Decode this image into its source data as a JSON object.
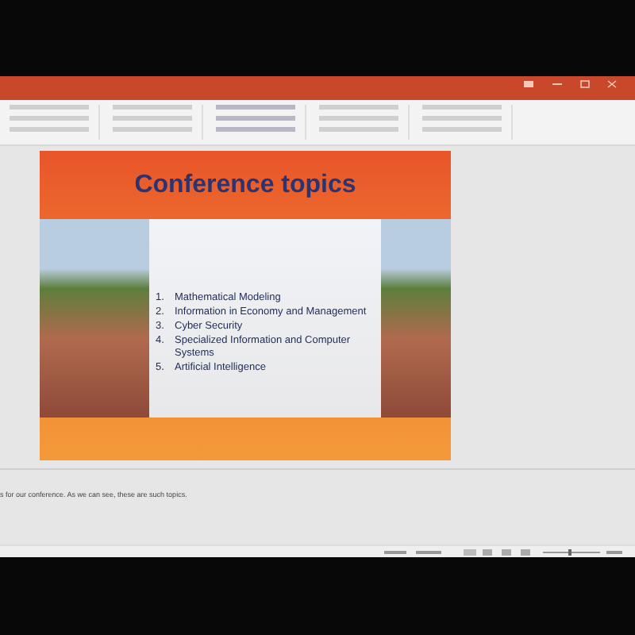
{
  "slide": {
    "title": "Conference topics",
    "topics": [
      {
        "number": "1.",
        "text": "Mathematical Modeling"
      },
      {
        "number": "2.",
        "text": "Information in Economy and Management"
      },
      {
        "number": "3.",
        "text": "Cyber Security"
      },
      {
        "number": "4.",
        "text": "Specialized Information and Computer Systems"
      },
      {
        "number": "5.",
        "text": "Artificial Intelligence"
      }
    ]
  },
  "notes": {
    "text": "s for our conference. As we can see, these are such topics."
  }
}
